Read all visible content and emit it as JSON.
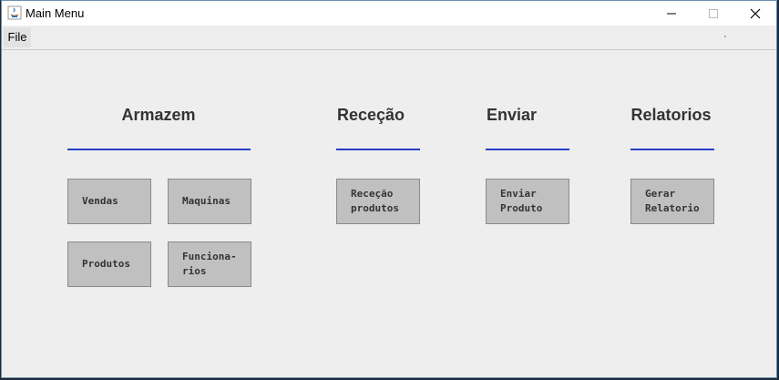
{
  "window": {
    "title": "Main Menu"
  },
  "menu": {
    "file": "File"
  },
  "sections": {
    "armazem": {
      "title": "Armazem",
      "buttons": {
        "vendas": "Vendas",
        "maquinas": "Maquinas",
        "produtos": "Produtos",
        "funcionarios": "Funciona-\nrios"
      }
    },
    "rececao": {
      "title": "Receção",
      "buttons": {
        "rececao_produtos": "Receção\nprodutos"
      }
    },
    "enviar": {
      "title": "Enviar",
      "buttons": {
        "enviar_produto": "Enviar\nProduto"
      }
    },
    "relatorios": {
      "title": "Relatorios",
      "buttons": {
        "gerar_relatorio": "Gerar\nRelatorio"
      }
    }
  },
  "colors": {
    "accent_underline": "#2440c8",
    "button_bg": "#c0c0c0",
    "window_bg": "#eeeeee"
  },
  "icons": {
    "app": "java-icon",
    "minimize": "minimize-icon",
    "maximize": "maximize-icon",
    "close": "close-icon"
  }
}
